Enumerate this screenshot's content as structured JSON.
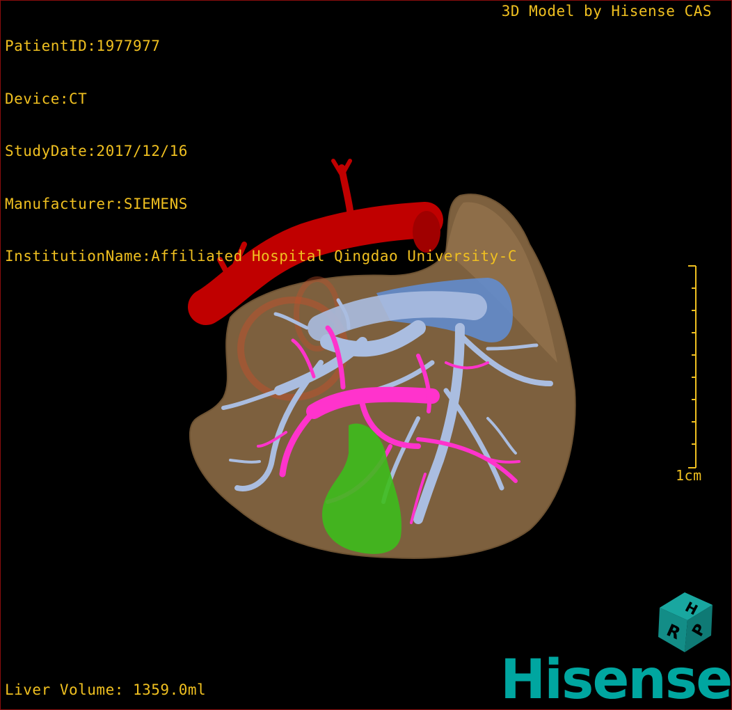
{
  "header": {
    "patient_id": "PatientID:1977977",
    "device": "Device:CT",
    "study_date": "StudyDate:2017/12/16",
    "manufacturer": "Manufacturer:SIEMENS",
    "institution": "InstitutionName:Affiliated Hospital Qingdao University-C",
    "credit": "3D Model by Hisense CAS"
  },
  "footer": {
    "liver_volume": "Liver Volume: 1359.0ml"
  },
  "scale": {
    "label": "1cm"
  },
  "orientation_cube": {
    "face_top": "H",
    "face_front": "R",
    "face_side": "P"
  },
  "brand": {
    "logo": "Hisense"
  },
  "colors": {
    "overlay_text": "#f0c020",
    "liver": "#8b6a45",
    "aorta": "#c00000",
    "portal_vein": "#aabde0",
    "hepatic_vein": "#ff33cc",
    "gallbladder": "#3dbd1c",
    "ivc": "#5f8ed6",
    "brand": "#00a6a0"
  }
}
